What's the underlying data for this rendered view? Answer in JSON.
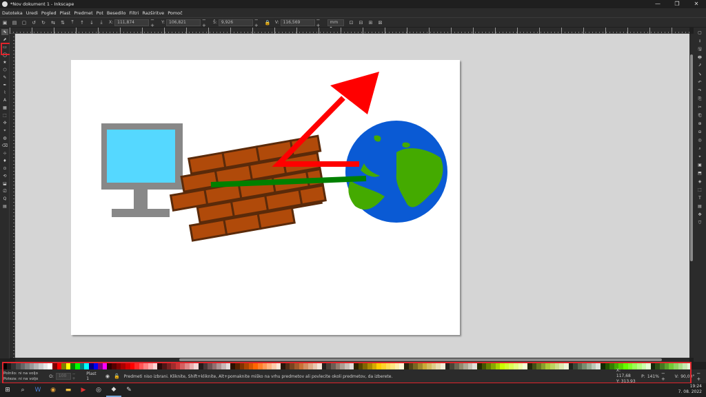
{
  "window": {
    "title": "*Nov dokument 1 - Inkscape",
    "min_label": "—",
    "max_label": "❐",
    "close_label": "✕"
  },
  "menu": [
    "Datoteka",
    "Uredi",
    "Pogled",
    "Plast",
    "Predmet",
    "Pot",
    "Besedilo",
    "Filtri",
    "Razširitve",
    "Pomoč"
  ],
  "toolcontrols": {
    "x_label": "X:",
    "x_value": "111,874",
    "y_label": "Y:",
    "y_value": "106,821",
    "w_label": "Š:",
    "w_value": "9,926",
    "h_label": "V:",
    "h_value": "116,569",
    "unit": "mm ▾"
  },
  "tools": [
    "⬉",
    "⬈",
    "▭",
    "◯",
    "★",
    "⬡",
    "✎",
    "✒",
    "⌇",
    "A",
    "▦",
    "⬚",
    "✣",
    "⌖",
    "◍",
    "⌫",
    "⊹",
    "♦",
    "⊙",
    "⟲",
    "⬓",
    "⎚",
    "Q",
    "▤"
  ],
  "commands": [
    "▢",
    "⭳",
    "🖫",
    "🖶",
    "⭷",
    "⭸",
    "↶",
    "↷",
    "⎘",
    "✂",
    "⎗",
    "⊕",
    "⊖",
    "◎",
    "⌕",
    "⌖",
    "▣",
    "⬒",
    "◈",
    "⬚",
    "T",
    "▤",
    "✥",
    "⛉"
  ],
  "palette_colors": [
    "#000000",
    "#1a1a1a",
    "#333333",
    "#4d4d4d",
    "#666666",
    "#808080",
    "#999999",
    "#b3b3b3",
    "#cccccc",
    "#e6e6e6",
    "#ffffff",
    "#800000",
    "#ff0000",
    "#808000",
    "#ffff00",
    "#008000",
    "#00ff00",
    "#008080",
    "#00ffff",
    "#000080",
    "#0000ff",
    "#800080",
    "#ff00ff",
    "#2b0000",
    "#550000",
    "#800000",
    "#aa0000",
    "#d40000",
    "#ff0000",
    "#ff2a2a",
    "#ff5555",
    "#ff8080",
    "#ffaaaa",
    "#ffd5d5",
    "#280b0b",
    "#501616",
    "#782121",
    "#a02c2c",
    "#c83737",
    "#d35f5f",
    "#de8787",
    "#e9afaf",
    "#f4d7d7",
    "#241c1c",
    "#483737",
    "#6c5353",
    "#916f6f",
    "#ac9393",
    "#c8b7b7",
    "#e3dbdb",
    "#2b1100",
    "#552200",
    "#803300",
    "#aa4400",
    "#d45500",
    "#ff6600",
    "#ff7f2a",
    "#ff9955",
    "#ffb380",
    "#ffccaa",
    "#ffe6d5",
    "#28170b",
    "#502d16",
    "#784421",
    "#a05a2c",
    "#c87137",
    "#d38d5f",
    "#deaa87",
    "#e9c6af",
    "#f4e3d7",
    "#241f1c",
    "#483e37",
    "#6c5d53",
    "#917c6f",
    "#ac9d93",
    "#c8beb7",
    "#e3dedb",
    "#2b2200",
    "#554400",
    "#806600",
    "#aa8800",
    "#d4aa00",
    "#ffcc00",
    "#ffd42a",
    "#ffdd55",
    "#ffe680",
    "#ffeeaa",
    "#fff6d5",
    "#28220b",
    "#504416",
    "#786721",
    "#a0892c",
    "#c8ab37",
    "#d3bc5f",
    "#decd87",
    "#e9ddaf",
    "#f4eed7",
    "#24221c",
    "#484537",
    "#6c6753",
    "#918a6f",
    "#aca793",
    "#c8c4b7",
    "#e3e2db",
    "#222b00",
    "#445500",
    "#668000",
    "#88aa00",
    "#aad400",
    "#ccff00",
    "#d4ff2a",
    "#ddff55",
    "#e5ff80",
    "#eeffaa",
    "#f6ffd5",
    "#22280b",
    "#445016",
    "#677821",
    "#89a02c",
    "#abc837",
    "#bcd35f",
    "#cdde87",
    "#dde9af",
    "#eef4d7",
    "#1e241c",
    "#3c4837",
    "#5a6c53",
    "#788e6f",
    "#99ac93",
    "#bbc8b7",
    "#dde3db",
    "#112b00",
    "#225500",
    "#338000",
    "#44aa00",
    "#55d400",
    "#66ff00",
    "#7fff2a",
    "#99ff55",
    "#b3ff80",
    "#ccffaa",
    "#e5ffd5",
    "#17280b",
    "#2d5016",
    "#447821",
    "#5aa02c",
    "#71c837",
    "#8dd35f",
    "#aade87",
    "#c6e9af",
    "#e3f4d7"
  ],
  "status": {
    "fill_label": "Polnilo:",
    "fill_value": "ni na voljo",
    "stroke_label": "Poteza:",
    "stroke_value": "ni na voljo",
    "opacity_label": "O:",
    "opacity_value": "100",
    "layer": "Plast 1",
    "message": "Predmeti niso izbrani. Kliknite, Shift+kliknite, Alt+pomaknite miško na vrhu predmetov ali povlecite okoli predmetov, da izberete.",
    "x_label": "X:",
    "x_value": "117,68",
    "y_label": "Y:",
    "y_value": "313,93",
    "zoom_label": "P:",
    "zoom_value": "141%",
    "rot_label": "V:",
    "rot_value": "90,00°"
  },
  "taskbar": {
    "time": "19:24",
    "date": "7. 08. 2022",
    "items": [
      "⊞",
      "⌕",
      "W",
      "◉",
      "▬",
      "▶",
      "◎",
      "◆",
      "✎"
    ]
  }
}
